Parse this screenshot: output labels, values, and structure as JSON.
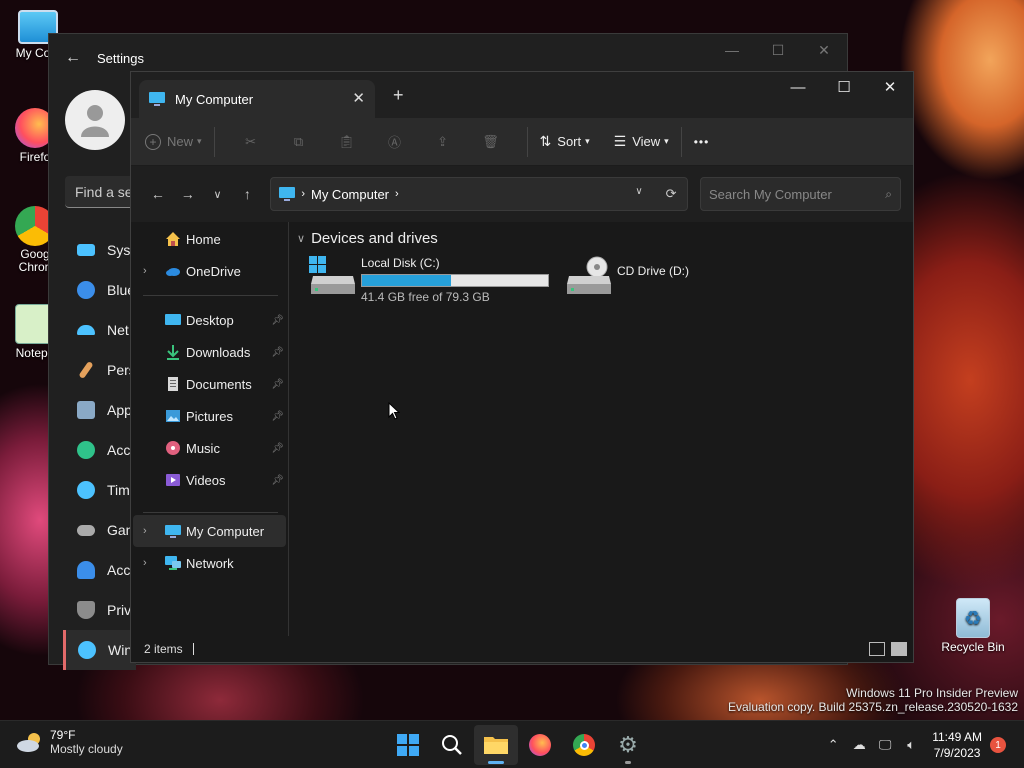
{
  "desktop": {
    "icons": [
      {
        "label": "My Com",
        "icon": "monitor-icon"
      },
      {
        "label": "Firefo",
        "icon": "firefox-icon"
      },
      {
        "label": "Goog Chron",
        "icon": "chrome-icon"
      },
      {
        "label": "Notepa",
        "icon": "notepad-icon"
      },
      {
        "label": "Recycle Bin",
        "icon": "recycle-bin-icon"
      }
    ]
  },
  "settings": {
    "title": "Settings",
    "search_placeholder": "Find a se",
    "nav": [
      {
        "label": "Syst",
        "icon": "system-icon",
        "color": "#4cc2ff"
      },
      {
        "label": "Blue",
        "icon": "bluetooth-icon",
        "color": "#3b8eea"
      },
      {
        "label": "Net",
        "icon": "wifi-icon",
        "color": "#4cc2ff"
      },
      {
        "label": "Pers",
        "icon": "brush-icon",
        "color": "#e4a15c"
      },
      {
        "label": "App",
        "icon": "apps-icon",
        "color": "#8aa9c6"
      },
      {
        "label": "Acc",
        "icon": "account-icon",
        "color": "#2fc28a"
      },
      {
        "label": "Tim",
        "icon": "clock-icon",
        "color": "#4cc2ff"
      },
      {
        "label": "Gan",
        "icon": "gamepad-icon",
        "color": "#aaaaaa"
      },
      {
        "label": "Acc",
        "icon": "accessibility-icon",
        "color": "#3b8eea"
      },
      {
        "label": "Priv",
        "icon": "shield-icon",
        "color": "#8c8c8c"
      },
      {
        "label": "Win",
        "icon": "update-icon",
        "color": "#4cc2ff"
      }
    ]
  },
  "explorer": {
    "tab_label": "My Computer",
    "toolbar": {
      "new_label": "New",
      "sort_label": "Sort",
      "view_label": "View",
      "more_label": "•••"
    },
    "address": {
      "path": "My Computer",
      "search_placeholder": "Search My Computer"
    },
    "sidebar": {
      "top": [
        {
          "label": "Home",
          "icon": "home-icon",
          "chevron": false
        },
        {
          "label": "OneDrive",
          "icon": "onedrive-icon",
          "chevron": true
        }
      ],
      "quick": [
        {
          "label": "Desktop",
          "icon": "desktop-icon"
        },
        {
          "label": "Downloads",
          "icon": "download-icon"
        },
        {
          "label": "Documents",
          "icon": "documents-icon"
        },
        {
          "label": "Pictures",
          "icon": "pictures-icon"
        },
        {
          "label": "Music",
          "icon": "music-icon"
        },
        {
          "label": "Videos",
          "icon": "videos-icon"
        }
      ],
      "bottom": [
        {
          "label": "My Computer",
          "icon": "monitor-icon",
          "selected": true
        },
        {
          "label": "Network",
          "icon": "network-icon",
          "selected": false
        }
      ]
    },
    "content": {
      "group_title": "Devices and drives",
      "drives": [
        {
          "name": "Local Disk (C:)",
          "free_text": "41.4 GB free of 79.3 GB",
          "used_fraction": 0.478,
          "icon": "hard-drive-icon"
        },
        {
          "name": "CD Drive (D:)",
          "icon": "cd-drive-icon"
        }
      ]
    },
    "status": {
      "count": "2 items"
    }
  },
  "watermark": {
    "line1": "Windows 11 Pro Insider Preview",
    "line2": "Evaluation copy. Build 25375.zn_release.230520-1632"
  },
  "taskbar": {
    "weather_temp": "79°F",
    "weather_desc": "Mostly cloudy",
    "time": "11:49 AM",
    "date": "7/9/2023",
    "notification_count": "1"
  }
}
